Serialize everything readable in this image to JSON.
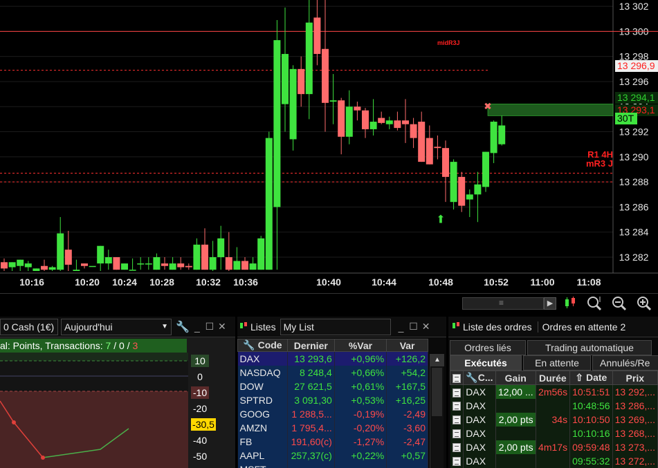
{
  "chart_data": {
    "type": "candlestick",
    "time_labels": [
      "10:16",
      "10:20",
      "10:24",
      "10:28",
      "10:32",
      "10:36",
      "10:40",
      "10:44",
      "10:48",
      "10:52",
      "11:00",
      "11:08"
    ],
    "price_labels": [
      "13 302",
      "13 300",
      "13 298",
      "13 296",
      "13 294",
      "13 292",
      "13 290",
      "13 288",
      "13 286",
      "13 284",
      "13 282"
    ],
    "price_range": [
      13280.9,
      13302.5
    ],
    "price_tags": [
      {
        "label": "13 296,9",
        "color": "#ff2020",
        "bg": "#f0f0f0",
        "price": 13296.9
      },
      {
        "label": "13 294,1",
        "color": "#2fd02f",
        "bg": "#0a2a0a",
        "price": 13294.1
      },
      {
        "label": "13 293,1",
        "color": "#ff2020",
        "bg": "#0a2a0a",
        "price": 13293.1
      },
      {
        "label": "30T",
        "color": "#000",
        "bg": "#3fe33f",
        "price": 13292.3
      }
    ],
    "annotations": [
      {
        "text": "midR3J",
        "color": "#ff2020"
      },
      {
        "text": "R1 4H",
        "color": "#ff2020"
      },
      {
        "text": "mR3 J",
        "color": "#ff2020"
      }
    ],
    "lines": [
      {
        "price": 13300.0,
        "style": "solid",
        "color": "#ff4444"
      },
      {
        "price": 13296.9,
        "style": "dashed",
        "color": "#ff3030"
      },
      {
        "price": 13288.7,
        "style": "dashed",
        "color": "#ff3030"
      },
      {
        "price": 13288.0,
        "style": "dashed",
        "color": "#ff3030"
      }
    ],
    "candles": [
      {
        "o": 13281.6,
        "h": 13281.9,
        "l": 13280.9,
        "c": 13281.1
      },
      {
        "o": 13281.2,
        "h": 13281.6,
        "l": 13280.9,
        "c": 13281.6
      },
      {
        "o": 13281.3,
        "h": 13281.8,
        "l": 13280.9,
        "c": 13281.8
      },
      {
        "o": 13281.2,
        "h": 13281.7,
        "l": 13280.9,
        "c": 13281.5
      },
      {
        "o": 13280.9,
        "h": 13281.1,
        "l": 13280.9,
        "c": 13281.1
      },
      {
        "o": 13281.3,
        "h": 13281.8,
        "l": 13280.9,
        "c": 13281.0
      },
      {
        "o": 13281.0,
        "h": 13281.3,
        "l": 13280.9,
        "c": 13281.2
      },
      {
        "o": 13281.0,
        "h": 13285.2,
        "l": 13280.9,
        "c": 13283.9
      },
      {
        "o": 13282.6,
        "h": 13284.1,
        "l": 13280.9,
        "c": 13281.4
      },
      {
        "o": 13280.9,
        "h": 13281.8,
        "l": 13280.9,
        "c": 13281.0
      },
      {
        "o": 13281.5,
        "h": 13281.5,
        "l": 13281.1,
        "c": 13281.3
      },
      {
        "o": 13281.3,
        "h": 13281.3,
        "l": 13281.3,
        "c": 13281.3
      },
      {
        "o": 13281.5,
        "h": 13282.0,
        "l": 13280.9,
        "c": 13282.9
      },
      {
        "o": 13281.5,
        "h": 13282.6,
        "l": 13281.0,
        "c": 13282.0
      },
      {
        "o": 13282.0,
        "h": 13281.5,
        "l": 13281.0,
        "c": 13281.0
      },
      {
        "o": 13281.0,
        "h": 13281.5,
        "l": 13281.0,
        "c": 13281.5
      },
      {
        "o": 13281.0,
        "h": 13281.9,
        "l": 13281.0,
        "c": 13281.0
      },
      {
        "o": 13281.5,
        "h": 13282.0,
        "l": 13281.0,
        "c": 13281.5
      },
      {
        "o": 13281.5,
        "h": 13282.0,
        "l": 13281.0,
        "c": 13281.5
      },
      {
        "o": 13281.0,
        "h": 13282.3,
        "l": 13281.0,
        "c": 13282.0
      },
      {
        "o": 13281.5,
        "h": 13282.0,
        "l": 13281.0,
        "c": 13281.3
      },
      {
        "o": 13281.0,
        "h": 13282.0,
        "l": 13281.0,
        "c": 13281.5
      },
      {
        "o": 13281.5,
        "h": 13282.0,
        "l": 13281.0,
        "c": 13281.2
      },
      {
        "o": 13281.3,
        "h": 13281.5,
        "l": 13281.0,
        "c": 13281.2
      },
      {
        "o": 13281.0,
        "h": 13283.5,
        "l": 13281.0,
        "c": 13283.0
      },
      {
        "o": 13283.0,
        "h": 13284.3,
        "l": 13281.0,
        "c": 13281.0
      },
      {
        "o": 13281.0,
        "h": 13283.3,
        "l": 13280.9,
        "c": 13282.0
      },
      {
        "o": 13282.0,
        "h": 13284.5,
        "l": 13281.0,
        "c": 13283.5
      },
      {
        "o": 13282.0,
        "h": 13284.0,
        "l": 13280.9,
        "c": 13281.0
      },
      {
        "o": 13281.0,
        "h": 13282.8,
        "l": 13281.0,
        "c": 13281.7
      },
      {
        "o": 13281.7,
        "h": 13282.0,
        "l": 13281.0,
        "c": 13281.0
      },
      {
        "o": 13281.0,
        "h": 13282.0,
        "l": 13281.0,
        "c": 13281.5
      },
      {
        "o": 13281.0,
        "h": 13283.7,
        "l": 13281.0,
        "c": 13283.5
      },
      {
        "o": 13281.0,
        "h": 13292.0,
        "l": 13281.0,
        "c": 13291.5
      },
      {
        "o": 13286.0,
        "h": 13300.9,
        "l": 13281.0,
        "c": 13299.3
      },
      {
        "o": 13294.2,
        "h": 13301.9,
        "l": 13292.0,
        "c": 13298.2
      },
      {
        "o": 13291.4,
        "h": 13297.3,
        "l": 13290.5,
        "c": 13297.0
      },
      {
        "o": 13297.0,
        "h": 13298.0,
        "l": 13294.0,
        "c": 13295.0
      },
      {
        "o": 13295.0,
        "h": 13303.0,
        "l": 13293.0,
        "c": 13300.7
      },
      {
        "o": 13301.1,
        "h": 13302.6,
        "l": 13297.3,
        "c": 13298.2
      },
      {
        "o": 13298.6,
        "h": 13302.6,
        "l": 13292.0,
        "c": 13294.3
      },
      {
        "o": 13294.4,
        "h": 13296.6,
        "l": 13292.6,
        "c": 13294.5
      },
      {
        "o": 13294.5,
        "h": 13294.7,
        "l": 13290.2,
        "c": 13291.6
      },
      {
        "o": 13291.6,
        "h": 13295.3,
        "l": 13291.0,
        "c": 13294.0
      },
      {
        "o": 13294.0,
        "h": 13294.4,
        "l": 13292.9,
        "c": 13293.7
      },
      {
        "o": 13293.7,
        "h": 13293.9,
        "l": 13291.5,
        "c": 13292.2
      },
      {
        "o": 13292.2,
        "h": 13294.6,
        "l": 13291.7,
        "c": 13292.8
      },
      {
        "o": 13293.1,
        "h": 13293.6,
        "l": 13292.6,
        "c": 13292.7
      },
      {
        "o": 13292.6,
        "h": 13293.2,
        "l": 13292.2,
        "c": 13292.9
      },
      {
        "o": 13292.9,
        "h": 13293.6,
        "l": 13292.1,
        "c": 13292.3
      },
      {
        "o": 13292.9,
        "h": 13294.6,
        "l": 13291.1,
        "c": 13292.6
      },
      {
        "o": 13292.6,
        "h": 13293.1,
        "l": 13290.7,
        "c": 13291.5
      },
      {
        "o": 13292.8,
        "h": 13293.6,
        "l": 13289.6,
        "c": 13289.6
      },
      {
        "o": 13291.5,
        "h": 13292.5,
        "l": 13289.4,
        "c": 13289.4
      },
      {
        "o": 13290.8,
        "h": 13291.7,
        "l": 13289.8,
        "c": 13290.7
      },
      {
        "o": 13290.7,
        "h": 13291.3,
        "l": 13286.4,
        "c": 13288.4
      },
      {
        "o": 13286.4,
        "h": 13289.8,
        "l": 13285.8,
        "c": 13289.6
      },
      {
        "o": 13288.4,
        "h": 13288.8,
        "l": 13285.6,
        "c": 13286.1
      },
      {
        "o": 13286.6,
        "h": 13287.4,
        "l": 13285.2,
        "c": 13287.0
      },
      {
        "o": 13287.0,
        "h": 13288.8,
        "l": 13284.8,
        "c": 13287.8
      },
      {
        "o": 13287.6,
        "h": 13290.4,
        "l": 13287.2,
        "c": 13290.4
      },
      {
        "o": 13290.3,
        "h": 13292.9,
        "l": 13289.5,
        "c": 13292.8
      },
      {
        "o": 13291.0,
        "h": 13293.9,
        "l": 13290.9,
        "c": 13292.5
      }
    ]
  },
  "toolbar": {
    "scroll_grip": "≡",
    "scroll_arrow": "▶",
    "icons": [
      "candles-toolbar-icon",
      "zoom-fit-icon",
      "zoom-out-icon",
      "zoom-in-icon"
    ]
  },
  "panel1": {
    "instrument": "0 Cash (1€)",
    "period": "Aujourd'hui",
    "info": "al: Points, Transactions: ",
    "counts": {
      "green": "7",
      "sep1": " / ",
      "zero": "0",
      "sep2": " / ",
      "red": "3"
    },
    "y_labels": [
      {
        "text": "10",
        "bg": "#2a4a2a",
        "color": "#fff"
      },
      {
        "text": "0",
        "bg": "transparent",
        "color": "#fff"
      },
      {
        "text": "-10",
        "bg": "#5a2a2a",
        "color": "#fff"
      },
      {
        "text": "-20",
        "bg": "transparent",
        "color": "#fff"
      },
      {
        "text": "-30,5",
        "bg": "#ffd700",
        "color": "#000"
      },
      {
        "text": "-40",
        "bg": "transparent",
        "color": "#fff"
      },
      {
        "text": "-50",
        "bg": "transparent",
        "color": "#fff"
      }
    ]
  },
  "panel2": {
    "title": "Listes",
    "list_name": "My List",
    "columns": [
      "Code",
      "Dernier",
      "%Var",
      "Var"
    ],
    "rows": [
      {
        "code": "DAX",
        "last": "13 293,6",
        "pct": "+0,96%",
        "var": "+126,2",
        "dir": "up",
        "sel": true
      },
      {
        "code": "NASDAQ",
        "last": "8 248,4",
        "pct": "+0,66%",
        "var": "+54,2",
        "dir": "up",
        "sel": false
      },
      {
        "code": "DOW",
        "last": "27 621,5",
        "pct": "+0,61%",
        "var": "+167,5",
        "dir": "up",
        "sel": false
      },
      {
        "code": "SPTRD",
        "last": "3 091,30",
        "pct": "+0,53%",
        "var": "+16,25",
        "dir": "up",
        "sel": false
      },
      {
        "code": "GOOG",
        "last": "1 288,5...",
        "pct": "-0,19%",
        "var": "-2,49",
        "dir": "down",
        "sel": false
      },
      {
        "code": "AMZN",
        "last": "1 795,4...",
        "pct": "-0,20%",
        "var": "-3,60",
        "dir": "down",
        "sel": false
      },
      {
        "code": "FB",
        "last": "191,60(c)",
        "pct": "-1,27%",
        "var": "-2,47",
        "dir": "down",
        "sel": false
      },
      {
        "code": "AAPL",
        "last": "257,37(c)",
        "pct": "+0,22%",
        "var": "+0,57",
        "dir": "up",
        "sel": false
      },
      {
        "code": "MSFT",
        "last": "",
        "pct": "",
        "var": "",
        "dir": "down",
        "sel": false
      }
    ]
  },
  "panel3": {
    "title": "Liste des ordres",
    "subtitle": "Ordres en attente 2",
    "tabs_row1": [
      "Ordres liés",
      "Trading automatique"
    ],
    "tabs_row2": [
      "Exécutés",
      "En attente",
      "Annulés/Re"
    ],
    "columns": [
      "C...",
      "Gain",
      "Durée",
      "Date",
      "Prix"
    ],
    "rows": [
      {
        "code": "DAX",
        "gain": "12,00 ...",
        "dur": "2m56s",
        "date": "10:51:51",
        "date_color": "red",
        "price": "13 292,..."
      },
      {
        "code": "DAX",
        "gain": "",
        "dur": "",
        "date": "10:48:56",
        "date_color": "green",
        "price": "13 286,..."
      },
      {
        "code": "DAX",
        "gain": "2,00 pts",
        "dur": "34s",
        "date": "10:10:50",
        "date_color": "red",
        "price": "13 269,..."
      },
      {
        "code": "DAX",
        "gain": "",
        "dur": "",
        "date": "10:10:16",
        "date_color": "green",
        "price": "13 268,..."
      },
      {
        "code": "DAX",
        "gain": "2,00 pts",
        "dur": "4m17s",
        "date": "09:59:48",
        "date_color": "red",
        "price": "13 273,..."
      },
      {
        "code": "DAX",
        "gain": "",
        "dur": "",
        "date": "09:55:32",
        "date_color": "green",
        "price": "13 272,..."
      }
    ]
  }
}
